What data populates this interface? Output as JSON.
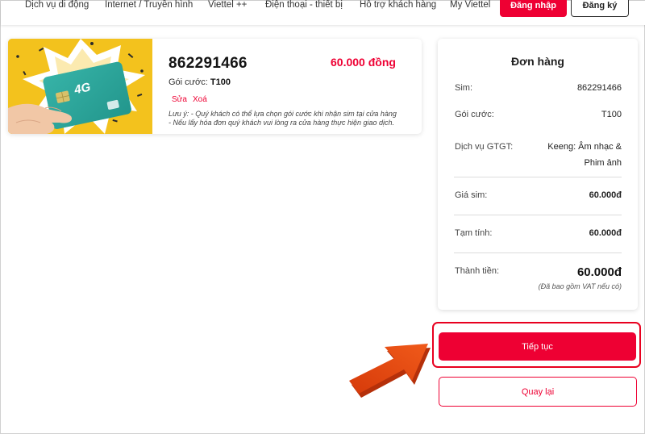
{
  "nav": {
    "items": [
      "Dịch vụ di động",
      "Internet / Truyền hình",
      "Viettel ++",
      "Điện thoại - thiết bị",
      "Hỗ trợ khách hàng",
      "My Viettel"
    ],
    "login": "Đăng nhập",
    "register": "Đăng ký"
  },
  "product": {
    "image_label": "4G",
    "number": "862291466",
    "price": "60.000 đồng",
    "plan_label": "Gói cước:",
    "plan_value": "T100",
    "edit": "Sửa",
    "delete": "Xoá",
    "note_line1": "Lưu ý: - Quý khách có thể lựa chọn gói cước khi nhận sim tại cửa hàng",
    "note_line2": "- Nếu lấy hóa đơn quý khách vui lòng ra cửa hàng thực hiện giao dịch."
  },
  "order": {
    "title": "Đơn hàng",
    "sim_label": "Sim:",
    "sim_value": "862291466",
    "plan_label": "Gói cước:",
    "plan_value": "T100",
    "vas_label": "Dịch vụ GTGT:",
    "vas_value_line1": "Keeng: Âm nhạc &",
    "vas_value_line2": "Phim ảnh",
    "sim_price_label": "Giá sim:",
    "sim_price_value": "60.000đ",
    "subtotal_label": "Tạm tính:",
    "subtotal_value": "60.000đ",
    "total_label": "Thành tiền:",
    "total_value": "60.000đ",
    "vat_note": "(Đã bao gồm VAT nếu có)"
  },
  "actions": {
    "continue": "Tiếp tục",
    "back": "Quay lại"
  },
  "colors": {
    "brand": "#ee0033",
    "arrow": "#e8430f",
    "card_yellow": "#f3c21d",
    "sim_teal": "#2aa59a"
  }
}
